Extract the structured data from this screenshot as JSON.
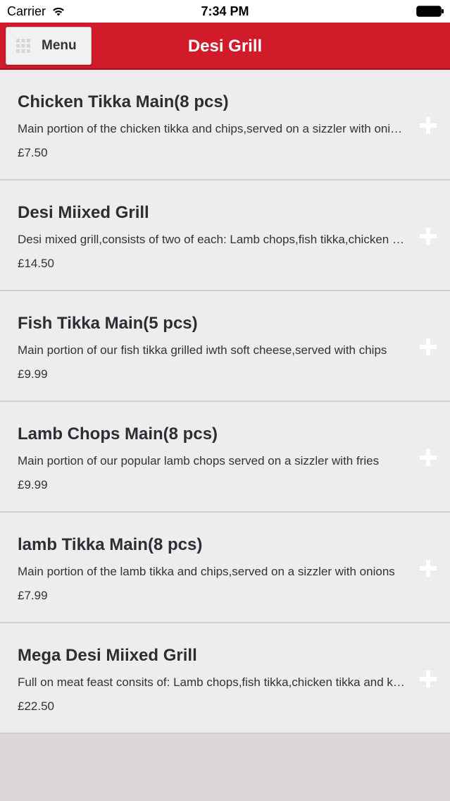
{
  "status_bar": {
    "carrier": "Carrier",
    "time": "7:34 PM",
    "wifi_icon": "wifi-icon",
    "battery_icon": "battery-icon"
  },
  "header": {
    "menu_label": "Menu",
    "menu_icon": "grid-icon",
    "title": "Desi Grill",
    "color": "#d11a2a"
  },
  "items": [
    {
      "name": "Chicken Tikka Main(8 pcs)",
      "description": "Main portion of the chicken tikka and chips,served on a sizzler with onions and peppers",
      "price": "£7.50"
    },
    {
      "name": "Desi Miixed Grill",
      "description": "Desi mixed grill,consists of two of each: Lamb chops,fish tikka,chicken tikka and seekh kebab",
      "price": "£14.50"
    },
    {
      "name": "Fish Tikka Main(5 pcs)",
      "description": "Main portion of our fish tikka grilled iwth soft cheese,served with chips",
      "price": "£9.99"
    },
    {
      "name": "Lamb Chops Main(8 pcs)",
      "description": "Main portion of our popular lamb chops served on a sizzler with fries",
      "price": "£9.99"
    },
    {
      "name": "lamb Tikka Main(8 pcs)",
      "description": "Main portion of the lamb tikka and chips,served on a sizzler with onions",
      "price": "£7.99"
    },
    {
      "name": "Mega Desi Miixed Grill",
      "description": "Full on meat feast consits of: Lamb chops,fish tikka,chicken tikka and kebabs",
      "price": "£22.50"
    }
  ]
}
